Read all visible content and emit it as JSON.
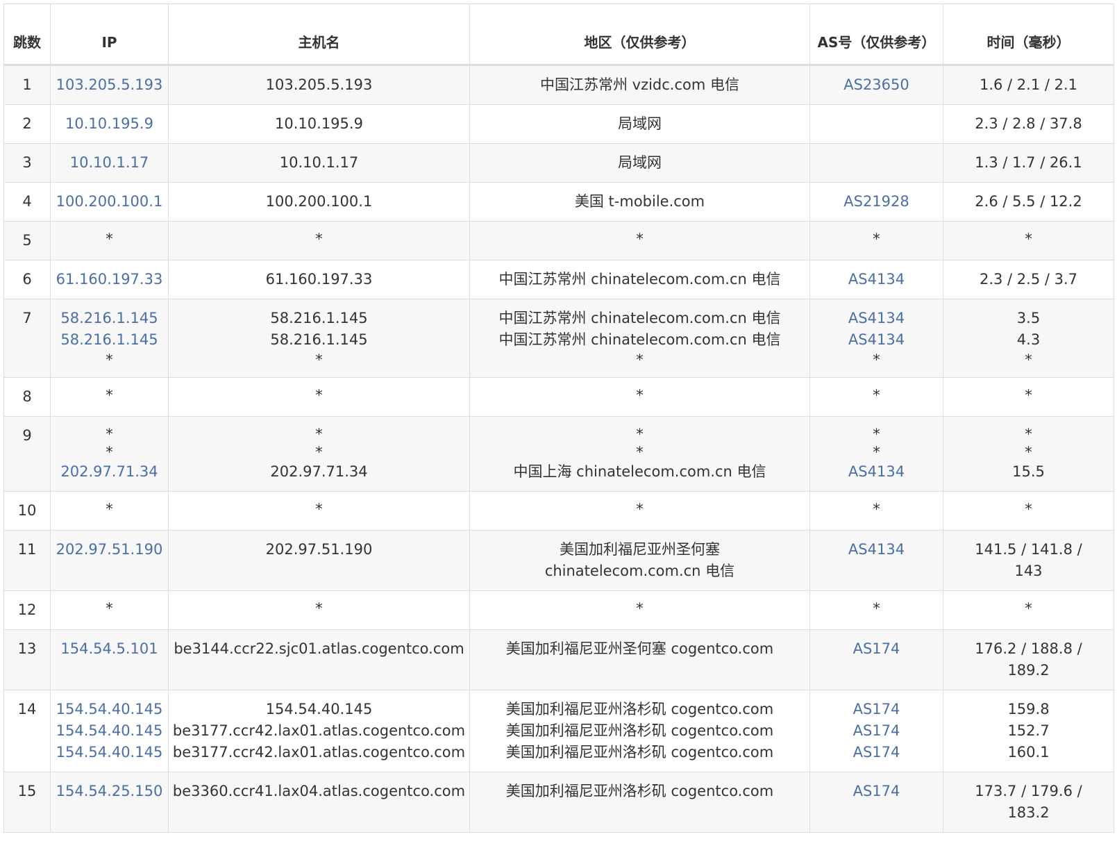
{
  "headers": {
    "hop": "跳数",
    "ip": "IP",
    "hostname": "主机名",
    "region": "地区（仅供参考）",
    "asn": "AS号（仅供参考）",
    "time": "时间（毫秒）"
  },
  "colors": {
    "link": "#4a6fa5",
    "stripe": "#f7f7f7",
    "border": "#dddddd",
    "text": "#333333"
  },
  "rows": [
    {
      "hop": "1",
      "ip": [
        "103.205.5.193"
      ],
      "hostname": [
        "103.205.5.193"
      ],
      "region": [
        "中国江苏常州 vzidc.com 电信"
      ],
      "asn": [
        "AS23650"
      ],
      "time": [
        "1.6 / 2.1 / 2.1"
      ]
    },
    {
      "hop": "2",
      "ip": [
        "10.10.195.9"
      ],
      "hostname": [
        "10.10.195.9"
      ],
      "region": [
        "局域网"
      ],
      "asn": [
        ""
      ],
      "time": [
        "2.3 / 2.8 / 37.8"
      ]
    },
    {
      "hop": "3",
      "ip": [
        "10.10.1.17"
      ],
      "hostname": [
        "10.10.1.17"
      ],
      "region": [
        "局域网"
      ],
      "asn": [
        ""
      ],
      "time": [
        "1.3 / 1.7 / 26.1"
      ]
    },
    {
      "hop": "4",
      "ip": [
        "100.200.100.1"
      ],
      "hostname": [
        "100.200.100.1"
      ],
      "region": [
        "美国 t-mobile.com"
      ],
      "asn": [
        "AS21928"
      ],
      "time": [
        "2.6 / 5.5 / 12.2"
      ]
    },
    {
      "hop": "5",
      "ip": [
        "*"
      ],
      "hostname": [
        "*"
      ],
      "region": [
        "*"
      ],
      "asn": [
        "*"
      ],
      "time": [
        "*"
      ]
    },
    {
      "hop": "6",
      "ip": [
        "61.160.197.33"
      ],
      "hostname": [
        "61.160.197.33"
      ],
      "region": [
        "中国江苏常州 chinatelecom.com.cn 电信"
      ],
      "asn": [
        "AS4134"
      ],
      "time": [
        "2.3 / 2.5 / 3.7"
      ]
    },
    {
      "hop": "7",
      "ip": [
        "58.216.1.145",
        "58.216.1.145",
        "*"
      ],
      "hostname": [
        "58.216.1.145",
        "58.216.1.145",
        "*"
      ],
      "region": [
        "中国江苏常州 chinatelecom.com.cn 电信",
        "中国江苏常州 chinatelecom.com.cn 电信",
        "*"
      ],
      "asn": [
        "AS4134",
        "AS4134",
        "*"
      ],
      "time": [
        "3.5",
        "4.3",
        "*"
      ]
    },
    {
      "hop": "8",
      "ip": [
        "*"
      ],
      "hostname": [
        "*"
      ],
      "region": [
        "*"
      ],
      "asn": [
        "*"
      ],
      "time": [
        "*"
      ]
    },
    {
      "hop": "9",
      "ip": [
        "*",
        "*",
        "202.97.71.34"
      ],
      "hostname": [
        "*",
        "*",
        "202.97.71.34"
      ],
      "region": [
        "*",
        "*",
        "中国上海 chinatelecom.com.cn 电信"
      ],
      "asn": [
        "*",
        "*",
        "AS4134"
      ],
      "time": [
        "*",
        "*",
        "15.5"
      ]
    },
    {
      "hop": "10",
      "ip": [
        "*"
      ],
      "hostname": [
        "*"
      ],
      "region": [
        "*"
      ],
      "asn": [
        "*"
      ],
      "time": [
        "*"
      ]
    },
    {
      "hop": "11",
      "ip": [
        "202.97.51.190"
      ],
      "hostname": [
        "202.97.51.190"
      ],
      "region": [
        "美国加利福尼亚州圣何塞",
        "chinatelecom.com.cn 电信"
      ],
      "asn": [
        "AS4134"
      ],
      "time": [
        "141.5 / 141.8 /",
        "143"
      ]
    },
    {
      "hop": "12",
      "ip": [
        "*"
      ],
      "hostname": [
        "*"
      ],
      "region": [
        "*"
      ],
      "asn": [
        "*"
      ],
      "time": [
        "*"
      ]
    },
    {
      "hop": "13",
      "ip": [
        "154.54.5.101"
      ],
      "hostname": [
        "be3144.ccr22.sjc01.atlas.cogentco.com"
      ],
      "region": [
        "美国加利福尼亚州圣何塞 cogentco.com"
      ],
      "asn": [
        "AS174"
      ],
      "time": [
        "176.2 / 188.8 /",
        "189.2"
      ]
    },
    {
      "hop": "14",
      "ip": [
        "154.54.40.145",
        "154.54.40.145",
        "154.54.40.145"
      ],
      "hostname": [
        "154.54.40.145",
        "be3177.ccr42.lax01.atlas.cogentco.com",
        "be3177.ccr42.lax01.atlas.cogentco.com"
      ],
      "region": [
        "美国加利福尼亚州洛杉矶 cogentco.com",
        "美国加利福尼亚州洛杉矶 cogentco.com",
        "美国加利福尼亚州洛杉矶 cogentco.com"
      ],
      "asn": [
        "AS174",
        "AS174",
        "AS174"
      ],
      "time": [
        "159.8",
        "152.7",
        "160.1"
      ]
    },
    {
      "hop": "15",
      "ip": [
        "154.54.25.150"
      ],
      "hostname": [
        "be3360.ccr41.lax04.atlas.cogentco.com"
      ],
      "region": [
        "美国加利福尼亚州洛杉矶 cogentco.com"
      ],
      "asn": [
        "AS174"
      ],
      "time": [
        "173.7 / 179.6 /",
        "183.2"
      ]
    }
  ]
}
